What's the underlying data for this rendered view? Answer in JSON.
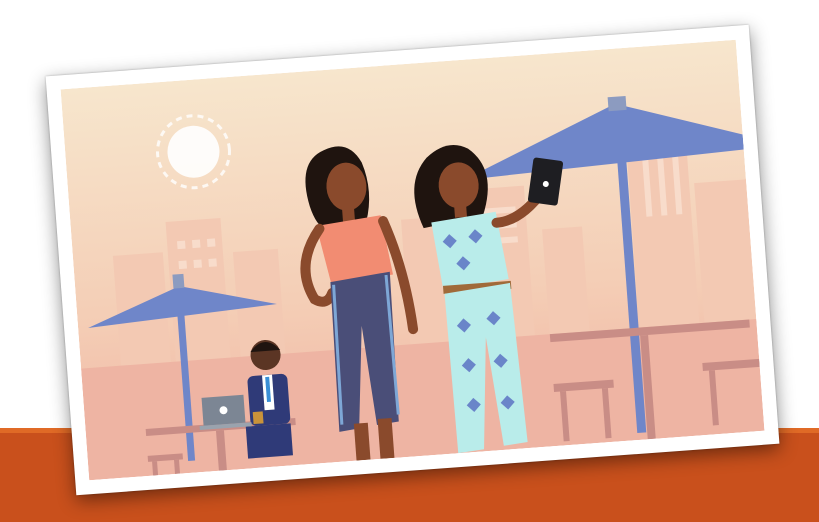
{
  "scene": {
    "description_elements": [
      "sun-icon",
      "umbrella-left",
      "umbrella-right",
      "man-with-laptop",
      "woman-in-orange-top",
      "woman-with-tablet",
      "city-skyline",
      "cafe-tables"
    ],
    "colors": {
      "band": "#c9501c",
      "sky_top": "#f6e2c8",
      "sky_bottom": "#f0b9a6",
      "umbrella": "#6f86c9",
      "buildings": "#f2c6b0",
      "table": "#c98d86"
    }
  }
}
